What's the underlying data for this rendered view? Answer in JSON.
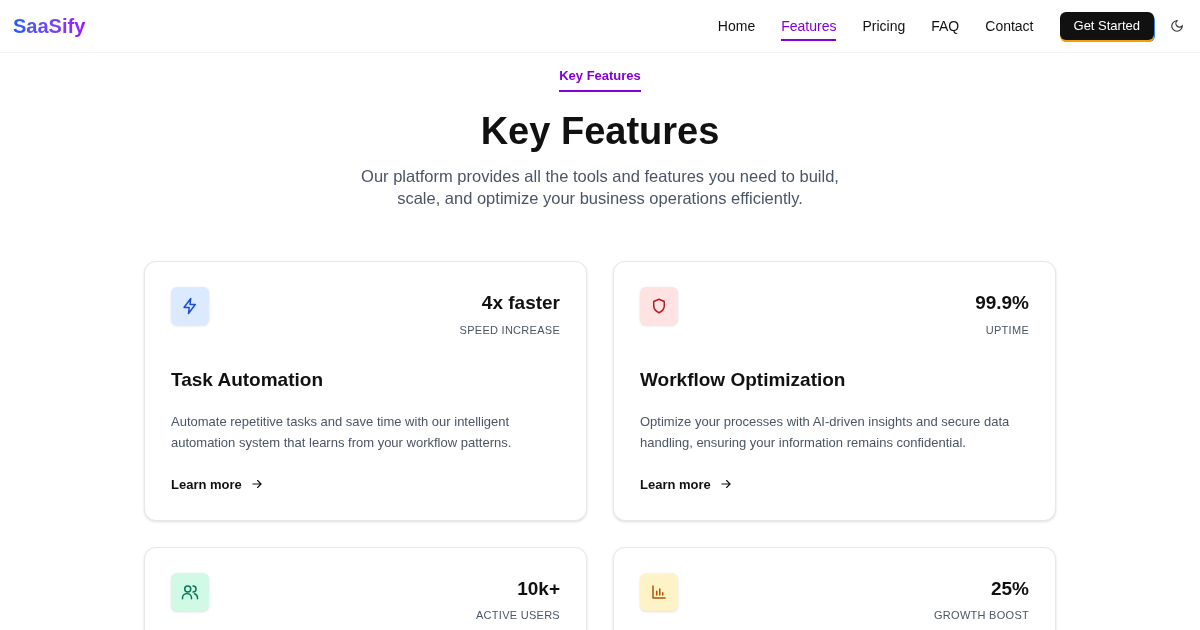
{
  "brand": "SaaSify",
  "nav": [
    {
      "label": "Home",
      "selected": false
    },
    {
      "label": "Features",
      "selected": true
    },
    {
      "label": "Pricing",
      "selected": false
    },
    {
      "label": "FAQ",
      "selected": false
    },
    {
      "label": "Contact",
      "selected": false
    }
  ],
  "cta": "Get Started",
  "section": {
    "eyebrow": "Key Features",
    "title": "Key Features",
    "subtitle": "Our platform provides all the tools and features you need to build, scale, and optimize your business operations efficiently."
  },
  "cards": [
    {
      "kind": "bolt",
      "stat": "4x faster",
      "stat_label": "SPEED INCREASE",
      "title": "Task Automation",
      "text": "Automate repetitive tasks and save time with our intelligent automation system that learns from your workflow patterns.",
      "link": "Learn more"
    },
    {
      "kind": "shield",
      "stat": "99.9%",
      "stat_label": "UPTIME",
      "title": "Workflow Optimization",
      "text": "Optimize your processes with AI-driven insights and secure data handling, ensuring your information remains confidential.",
      "link": "Learn more"
    },
    {
      "kind": "users",
      "stat": "10k+",
      "stat_label": "ACTIVE USERS"
    },
    {
      "kind": "chart",
      "stat": "25%",
      "stat_label": "GROWTH BOOST"
    }
  ]
}
